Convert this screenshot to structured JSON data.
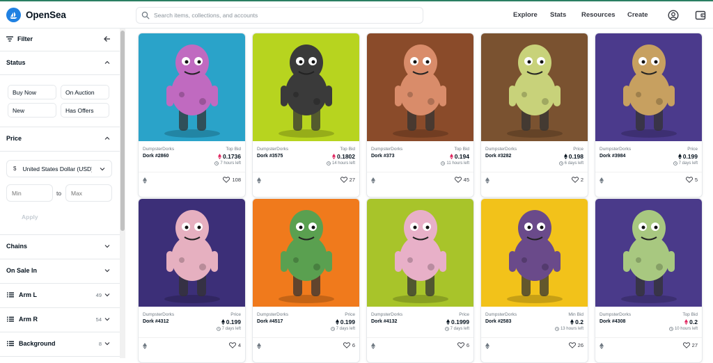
{
  "brand": {
    "name": "OpenSea",
    "accent": "#2081e2"
  },
  "search": {
    "placeholder": "Search items, collections, and accounts"
  },
  "nav": {
    "explore": "Explore",
    "stats": "Stats",
    "resources": "Resources",
    "create": "Create"
  },
  "sidebar": {
    "filter_label": "Filter",
    "status": {
      "title": "Status",
      "buy_now": "Buy Now",
      "on_auction": "On Auction",
      "new": "New",
      "has_offers": "Has Offers"
    },
    "price": {
      "title": "Price",
      "currency": "United States Dollar (USD)",
      "currency_symbol": "$",
      "min_placeholder": "Min",
      "max_placeholder": "Max",
      "to": "to",
      "apply": "Apply"
    },
    "chains": "Chains",
    "on_sale_in": "On Sale In",
    "traits": [
      {
        "label": "Arm L",
        "count": "49"
      },
      {
        "label": "Arm R",
        "count": "54"
      },
      {
        "label": "Background",
        "count": "8"
      }
    ]
  },
  "cards": [
    {
      "collection": "DumpsterDorks",
      "name": "Dork #2860",
      "price_label": "Top Bid",
      "price": "0.1736",
      "time": "7 hours left",
      "likes": "108",
      "bg": "#2aa3c9",
      "body": "#c06ac0",
      "eth_color": "#e0245e"
    },
    {
      "collection": "DumpsterDorks",
      "name": "Dork #3575",
      "price_label": "Top Bid",
      "price": "0.1802",
      "time": "14 hours left",
      "likes": "27",
      "bg": "#b7d41f",
      "body": "#3a3a3a",
      "eth_color": "#e0245e"
    },
    {
      "collection": "DumpsterDorks",
      "name": "Dork #373",
      "price_label": "Top Bid",
      "price": "0.194",
      "time": "11 hours left",
      "likes": "45",
      "bg": "#8a4b2a",
      "body": "#d98c6a",
      "eth_color": "#e0245e"
    },
    {
      "collection": "DumpsterDorks",
      "name": "Dork #3282",
      "price_label": "Price",
      "price": "0.198",
      "time": "6 days left",
      "likes": "2",
      "bg": "#7a5230",
      "body": "#c8d27a",
      "eth_color": "#04111d"
    },
    {
      "collection": "DumpsterDorks",
      "name": "Dork #3984",
      "price_label": "Price",
      "price": "0.199",
      "time": "7 days left",
      "likes": "5",
      "bg": "#4b3a8c",
      "body": "#c7a060",
      "eth_color": "#04111d"
    },
    {
      "collection": "DumpsterDorks",
      "name": "Dork #4312",
      "price_label": "Price",
      "price": "0.199",
      "time": "7 days left",
      "likes": "4",
      "bg": "#3c2f78",
      "body": "#e6b0c0",
      "eth_color": "#04111d"
    },
    {
      "collection": "DumpsterDorks",
      "name": "Dork #4517",
      "price_label": "Price",
      "price": "0.199",
      "time": "7 days left",
      "likes": "6",
      "bg": "#f07a1c",
      "body": "#5aa050",
      "eth_color": "#04111d"
    },
    {
      "collection": "DumpsterDorks",
      "name": "Dork #4132",
      "price_label": "Price",
      "price": "0.1999",
      "time": "7 days left",
      "likes": "6",
      "bg": "#a8c42a",
      "body": "#e8b0c8",
      "eth_color": "#04111d"
    },
    {
      "collection": "DumpsterDorks",
      "name": "Dork #2583",
      "price_label": "Min Bid",
      "price": "0.2",
      "time": "13 hours left",
      "likes": "26",
      "bg": "#f2c21a",
      "body": "#6a4a8a",
      "eth_color": "#04111d"
    },
    {
      "collection": "DumpsterDorks",
      "name": "Dork #4308",
      "price_label": "Top Bid",
      "price": "0.2",
      "time": "10 hours left",
      "likes": "27",
      "bg": "#4a3a8a",
      "body": "#a8c880",
      "eth_color": "#e0245e"
    }
  ]
}
